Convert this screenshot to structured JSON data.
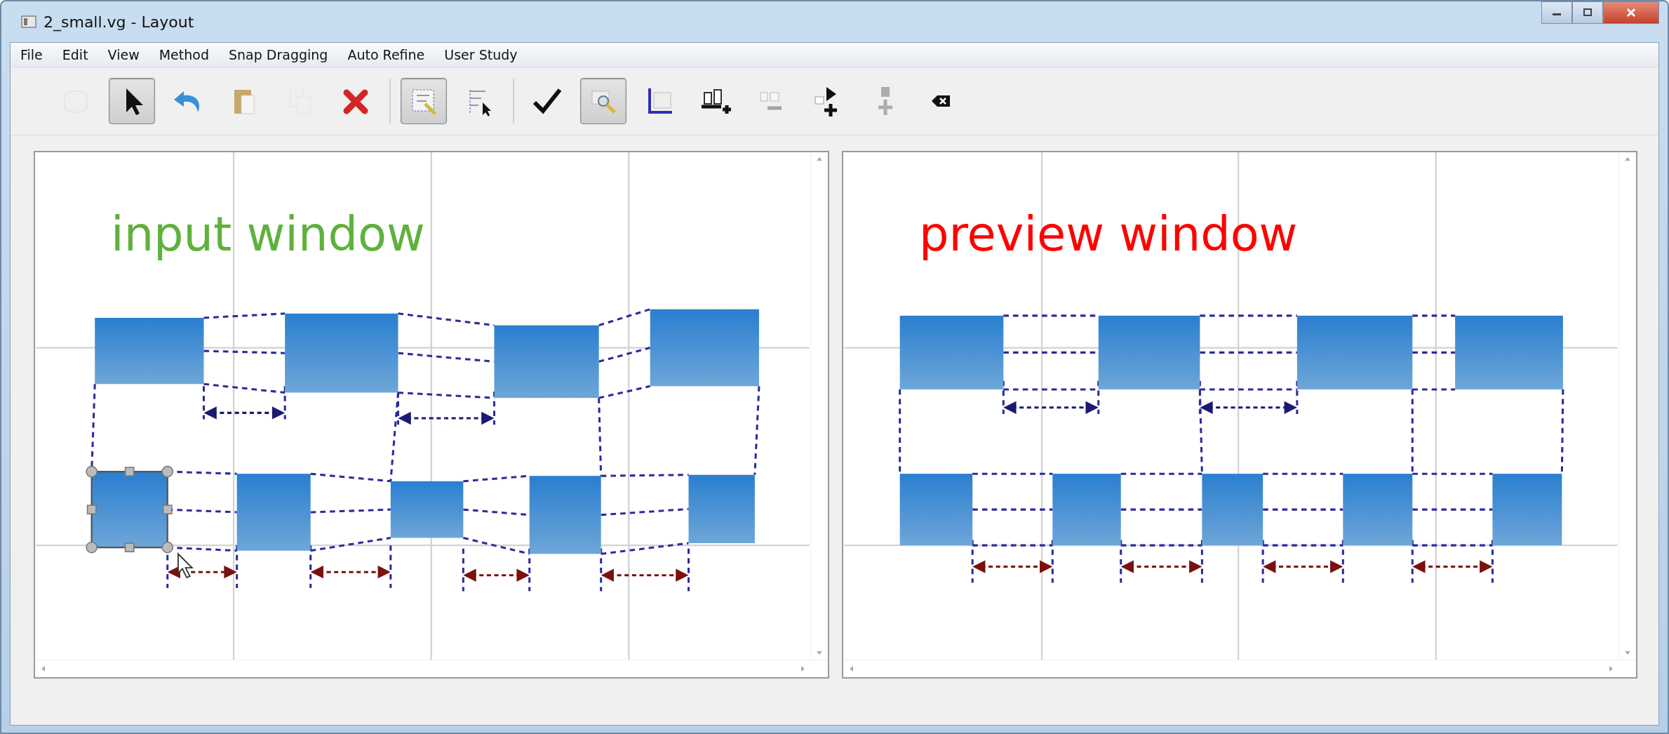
{
  "window": {
    "title": "2_small.vg - Layout"
  },
  "menu": [
    "File",
    "Edit",
    "View",
    "Method",
    "Snap Dragging",
    "Auto Refine",
    "User Study"
  ],
  "toolbar": [
    [
      {
        "kind": "shape",
        "selected": false,
        "disabled": true
      },
      {
        "kind": "pointer",
        "selected": true,
        "disabled": false
      },
      {
        "kind": "undo",
        "selected": false,
        "disabled": false
      },
      {
        "kind": "paste",
        "selected": false,
        "disabled": false
      },
      {
        "kind": "copy",
        "selected": false,
        "disabled": true
      },
      {
        "kind": "delete",
        "selected": false,
        "disabled": false
      }
    ],
    [
      {
        "kind": "select-box",
        "selected": true,
        "disabled": false
      },
      {
        "kind": "select-rows",
        "selected": false,
        "disabled": false
      }
    ],
    [
      {
        "kind": "check",
        "selected": false,
        "disabled": false
      },
      {
        "kind": "zoom",
        "selected": true,
        "disabled": false
      },
      {
        "kind": "axis",
        "selected": false,
        "disabled": false
      },
      {
        "kind": "add-row",
        "selected": false,
        "disabled": false
      },
      {
        "kind": "remove-row",
        "selected": false,
        "disabled": true
      },
      {
        "kind": "add-play",
        "selected": false,
        "disabled": false
      },
      {
        "kind": "add-stop",
        "selected": false,
        "disabled": true
      },
      {
        "kind": "backspace",
        "selected": false,
        "disabled": false
      }
    ]
  ],
  "canvases": [
    {
      "label": "input window",
      "color": "#5fb13c"
    },
    {
      "label": "preview window",
      "color": "#ff0000"
    }
  ]
}
